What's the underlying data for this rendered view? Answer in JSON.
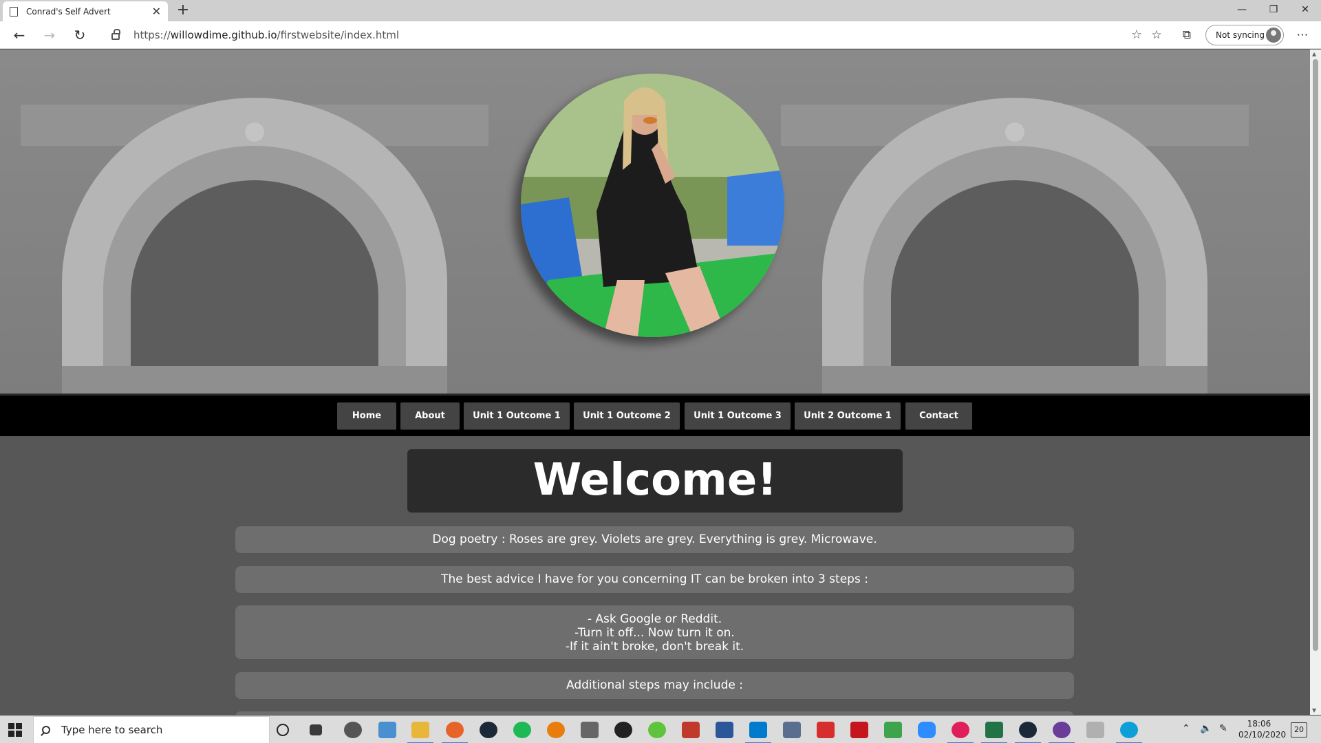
{
  "browser": {
    "tab_title": "Conrad's Self Advert",
    "url_prefix": "https://",
    "url_domain": "willowdime.github.io",
    "url_path": "/firstwebsite/index.html",
    "sync_label": "Not syncing"
  },
  "site": {
    "nav": [
      "Home",
      "About",
      "Unit 1 Outcome 1",
      "Unit 1 Outcome 2",
      "Unit 1 Outcome 3",
      "Unit 2 Outcome 1",
      "Contact"
    ],
    "welcome": "Welcome!",
    "card1": "Dog poetry : Roses are grey. Violets are grey. Everything is grey. Microwave.",
    "card2": "The best advice I have for you concerning IT can be broken into 3 steps :",
    "card3_line1": "- Ask Google or Reddit.",
    "card3_line2": "-Turn it off... Now turn it on.",
    "card3_line3": "-If it ain't broke, don't break it.",
    "card4": "Additional steps may include :"
  },
  "taskbar": {
    "search_placeholder": "Type here to search",
    "time": "18:06",
    "date": "02/10/2020",
    "notifications": "20"
  },
  "colors": {
    "nav_bg": "#000000",
    "nav_button": "#444444",
    "welcome_bg": "#2b2b2b",
    "card_bg": "#6e6e6e",
    "page_bg": "#575757"
  }
}
